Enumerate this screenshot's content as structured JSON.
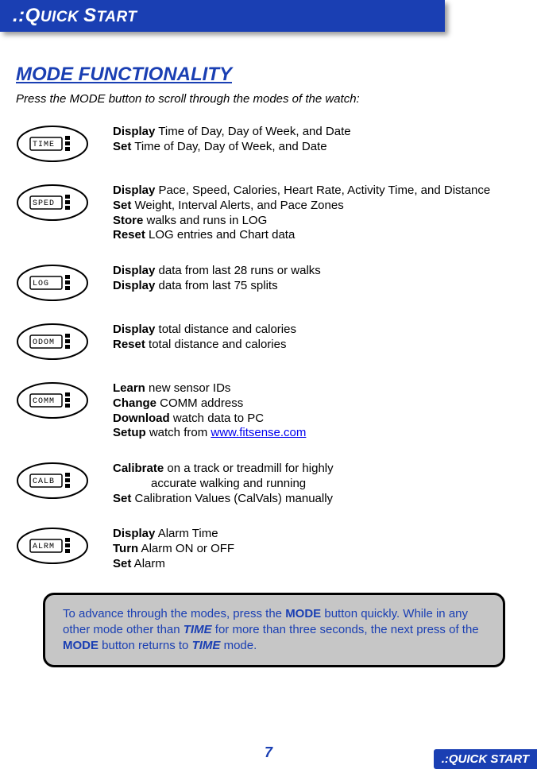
{
  "header": {
    "title": ".:QUICK START",
    "title_sc_prefix": ".:Q",
    "title_sc_mid": "UICK ",
    "title_sc_s": "S",
    "title_sc_rest": "TART"
  },
  "section": {
    "title": "MODE FUNCTIONALITY"
  },
  "intro": "Press the MODE button to scroll through the modes of the watch:",
  "modes": [
    {
      "icon_label": "TIME",
      "lines": [
        {
          "b": "Display",
          "t": " Time of Day, Day of Week, and Date"
        },
        {
          "b": "Set",
          "t": " Time of Day, Day of Week, and Date"
        }
      ]
    },
    {
      "icon_label": "SPED",
      "lines": [
        {
          "b": "Display",
          "t": " Pace, Speed, Calories, Heart Rate, Activity Time, and Distance"
        },
        {
          "b": "Set",
          "t": " Weight, Interval Alerts, and Pace Zones"
        },
        {
          "b": "Store",
          "t": " walks and runs in LOG"
        },
        {
          "b": "Reset",
          "t": " LOG entries and Chart data"
        }
      ]
    },
    {
      "icon_label": "LOG",
      "lines": [
        {
          "b": "Display",
          "t": " data from last 28 runs or walks"
        },
        {
          "b": "Display",
          "t": " data from last 75 splits"
        }
      ]
    },
    {
      "icon_label": "ODOM",
      "lines": [
        {
          "b": "Display",
          "t": " total distance and calories"
        },
        {
          "b": "Reset",
          "t": " total distance and calories"
        }
      ]
    },
    {
      "icon_label": "COMM",
      "lines": [
        {
          "b": "Learn",
          "t": " new sensor IDs"
        },
        {
          "b": "Change",
          "t": " COMM address"
        },
        {
          "b": "Download",
          "t": " watch data to PC"
        },
        {
          "b": "Setup",
          "t": " watch from ",
          "link": "www.fitsense.com"
        }
      ]
    },
    {
      "icon_label": "CALB",
      "lines": [
        {
          "b": "Calibrate",
          "t": " on a track or treadmill for highly"
        },
        {
          "indent": true,
          "t": "accurate walking and running"
        },
        {
          "b": "Set",
          "t": " Calibration Values (CalVals) manually"
        }
      ]
    },
    {
      "icon_label": "ALRM",
      "lines": [
        {
          "b": "Display",
          "t": " Alarm Time"
        },
        {
          "b": "Turn",
          "t": " Alarm ON or OFF"
        },
        {
          "b": "Set",
          "t": " Alarm"
        }
      ]
    }
  ],
  "tip": {
    "p1": "To advance through the modes, press the ",
    "p2": "MODE",
    "p3": " button quickly.  While in any other mode other than ",
    "p4": "TIME",
    "p5": " for more than three seconds, the next press of the ",
    "p6": "MODE",
    "p7": " button returns to ",
    "p8": "TIME",
    "p9": " mode."
  },
  "footer": {
    "page": "7",
    "label": ".:QUICK START"
  }
}
